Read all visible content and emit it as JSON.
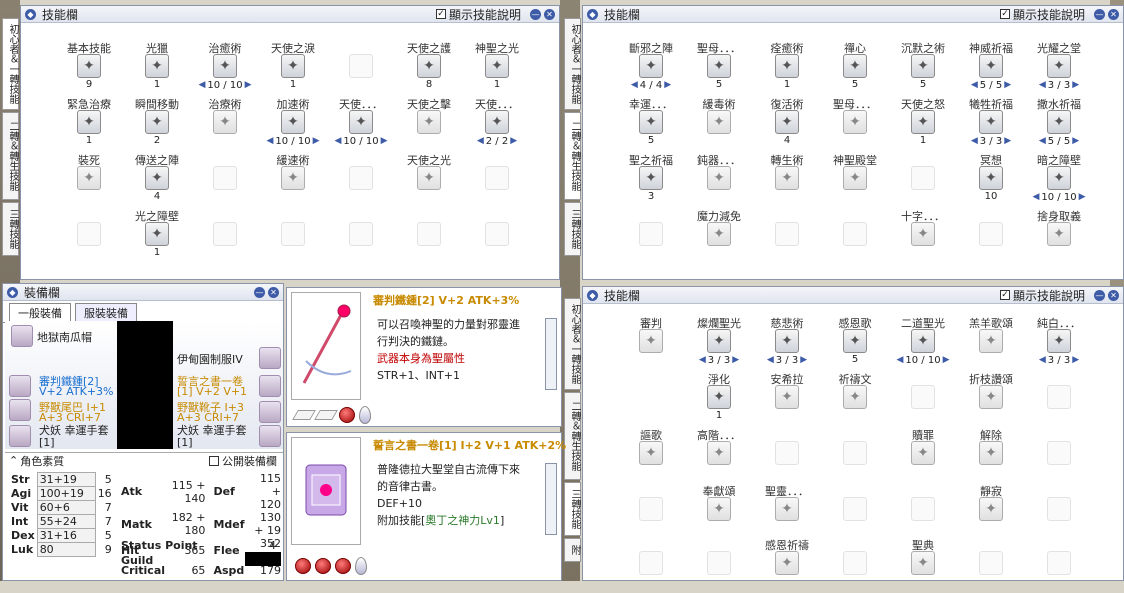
{
  "skill_tabs": [
    "初心者＆一轉技能",
    "二轉＆轉生技能",
    "三轉技能"
  ],
  "skill_tabs_short": [
    "三轉技能",
    "附"
  ],
  "win1": {
    "title": "技能欄",
    "show_desc": "顯示技能說明",
    "skills": [
      {
        "name": "基本技能",
        "level": "9",
        "icon": "chat-icon"
      },
      {
        "name": "光獵",
        "level": "1",
        "icon": "orb-icon"
      },
      {
        "name": "治癒術",
        "level": "10 / 10",
        "icon": "heart-icon",
        "ctl": true
      },
      {
        "name": "天使之淚",
        "level": "1",
        "icon": "tear-icon"
      },
      {
        "name": "天使之護",
        "level": "8",
        "icon": "wing-icon"
      },
      {
        "name": "神聖之光",
        "level": "1",
        "icon": "light-icon"
      },
      {
        "name": "緊急治療",
        "level": "1",
        "icon": "cross-icon"
      },
      {
        "name": "瞬間移動",
        "level": "2",
        "icon": "warp-icon"
      },
      {
        "name": "治療術",
        "level": "",
        "icon": "heart-gray-icon",
        "gray": true
      },
      {
        "name": "加速術",
        "level": "10 / 10",
        "icon": "speed-icon",
        "ctl": true
      },
      {
        "name": "天使．．．",
        "level": "10 / 10",
        "icon": "halo-icon",
        "ctl": true
      },
      {
        "name": "天使之擊",
        "level": "",
        "icon": "blade-icon",
        "gray": true
      },
      {
        "name": "天使．．．",
        "level": "2 / 2",
        "icon": "bell-icon",
        "ctl": true
      },
      {
        "name": "裝死",
        "level": "",
        "icon": "skull-icon",
        "gray": true
      },
      {
        "name": "傳送之陣",
        "level": "4",
        "icon": "portal-icon"
      },
      {
        "name": "緩速術",
        "level": "",
        "icon": "slow-icon",
        "gray": true
      },
      {
        "name": "天使之光",
        "level": "",
        "icon": "ring-icon",
        "gray": true
      },
      {
        "name": "光之障壁",
        "level": "1",
        "icon": "shield-icon"
      }
    ]
  },
  "win2": {
    "title": "技能欄",
    "show_desc": "顯示技能說明",
    "skills": [
      {
        "name": "斷邪之陣",
        "level": "4 / 4",
        "icon": "star-icon",
        "ctl": true
      },
      {
        "name": "聖母．．．",
        "level": "5",
        "icon": "mother-icon"
      },
      {
        "name": "痊癒術",
        "level": "1",
        "icon": "cure-icon"
      },
      {
        "name": "禪心",
        "level": "5",
        "icon": "zen-icon"
      },
      {
        "name": "沉默之術",
        "level": "5",
        "icon": "silence-icon"
      },
      {
        "name": "神威祈福",
        "level": "5 / 5",
        "icon": "bless-icon",
        "ctl": true
      },
      {
        "name": "光耀之堂",
        "level": "3 / 3",
        "icon": "hall-icon",
        "ctl": true
      },
      {
        "name": "幸運．．．",
        "level": "5",
        "icon": "luck-icon"
      },
      {
        "name": "緩毒術",
        "level": "",
        "icon": "poison-icon",
        "gray": true
      },
      {
        "name": "復活術",
        "level": "4",
        "icon": "revive-icon"
      },
      {
        "name": "聖母．．．",
        "level": "",
        "icon": "mother2-icon",
        "gray": true
      },
      {
        "name": "天使之怒",
        "level": "1",
        "icon": "wrath-icon"
      },
      {
        "name": "犧牲祈福",
        "level": "3 / 3",
        "icon": "sacrifice-icon",
        "ctl": true
      },
      {
        "name": "撒水祈福",
        "level": "5 / 5",
        "icon": "water-icon",
        "ctl": true
      },
      {
        "name": "聖之祈福",
        "level": "3",
        "icon": "holy-bless-icon"
      },
      {
        "name": "鈍器．．．",
        "level": "",
        "icon": "mace-icon",
        "gray": true
      },
      {
        "name": "轉生術",
        "level": "",
        "icon": "rebirth-icon",
        "gray": true
      },
      {
        "name": "神聖殿堂",
        "level": "",
        "icon": "temple-icon",
        "gray": true
      },
      {
        "name": "冥想",
        "level": "10",
        "icon": "meditate-icon"
      },
      {
        "name": "暗之障壁",
        "level": "10 / 10",
        "icon": "dark-shield-icon",
        "ctl": true
      },
      {
        "name": "魔力減免",
        "level": "",
        "icon": "spark-icon",
        "gray": true
      },
      {
        "name": "十字．．．",
        "level": "",
        "icon": "cross2-icon",
        "gray": true
      },
      {
        "name": "捨身取義",
        "level": "",
        "icon": "burst-icon",
        "gray": true
      }
    ]
  },
  "win3": {
    "title": "技能欄",
    "show_desc": "顯示技能說明",
    "skills": [
      {
        "name": "審判",
        "level": "",
        "icon": "judge-icon",
        "gray": true
      },
      {
        "name": "燦爛聖光",
        "level": "3 / 3",
        "icon": "radiant-icon",
        "ctl": true
      },
      {
        "name": "慈悲術",
        "level": "3 / 3",
        "icon": "mercy-icon",
        "ctl": true
      },
      {
        "name": "感恩歌",
        "level": "5",
        "icon": "thanks-icon"
      },
      {
        "name": "二道聖光",
        "level": "10 / 10",
        "icon": "double-light-icon",
        "ctl": true
      },
      {
        "name": "羔羊歌頌",
        "level": "",
        "icon": "lamb-icon",
        "gray": true
      },
      {
        "name": "純白．．．",
        "level": "3 / 3",
        "icon": "white-icon",
        "ctl": true
      },
      {
        "name": "淨化",
        "level": "1",
        "icon": "purify-icon"
      },
      {
        "name": "安希拉",
        "level": "",
        "icon": "ansira-icon",
        "gray": true
      },
      {
        "name": "祈禱文",
        "level": "",
        "icon": "prayer-icon",
        "gray": true
      },
      {
        "name": "折枝讚頌",
        "level": "",
        "icon": "branch-icon",
        "gray": true
      },
      {
        "name": "謳歌",
        "level": "",
        "icon": "song-icon",
        "gray": true
      },
      {
        "name": "高階．．．",
        "level": "",
        "icon": "high-icon",
        "gray": true
      },
      {
        "name": "贖罪",
        "level": "",
        "icon": "atone-icon",
        "gray": true
      },
      {
        "name": "解除",
        "level": "",
        "icon": "release-icon",
        "gray": true
      },
      {
        "name": "奉獻頌",
        "level": "",
        "icon": "offer-icon",
        "gray": true
      },
      {
        "name": "聖靈．．．",
        "level": "",
        "icon": "spirit-icon",
        "gray": true
      },
      {
        "name": "靜寂",
        "level": "",
        "icon": "quiet-icon",
        "gray": true
      },
      {
        "name": "感恩祈禱",
        "level": "",
        "icon": "grace-icon",
        "gray": true
      },
      {
        "name": "聖典",
        "level": "",
        "icon": "scripture-icon",
        "gray": true
      }
    ]
  },
  "equip": {
    "title": "裝備欄",
    "tab_general": "一般裝備",
    "tab_costume": "服裝裝備",
    "head": "地獄南瓜帽",
    "armor": "伊甸園制服IV",
    "weapon_line1": "審判鐵鍾[2]",
    "weapon_line2": "V+2 ATK+3%",
    "shield_line1": "誓言之書一卷",
    "shield_line2": "[1] V+2 V+1",
    "garment_line1": "野獸尾巴 I+1",
    "garment_line2": "A+3 CRI+7",
    "shoes_line1": "野獸靴子 I+3",
    "shoes_line2": "A+3 CRI+7",
    "acc1": "犬妖 幸運手套 [1]",
    "acc2": "犬妖 幸運手套 [1]",
    "stats_label": "角色素質",
    "public_label": "公開裝備欄"
  },
  "stats": [
    {
      "k": "Str",
      "v": "31+19",
      "n": "5"
    },
    {
      "k": "Agi",
      "v": "100+19",
      "n": "16"
    },
    {
      "k": "Vit",
      "v": "60+6",
      "n": "7"
    },
    {
      "k": "Int",
      "v": "55+24",
      "n": "7"
    },
    {
      "k": "Dex",
      "v": "31+16",
      "n": "5"
    },
    {
      "k": "Luk",
      "v": "80",
      "n": "9"
    }
  ],
  "stats2": [
    {
      "k": "Atk",
      "v": "115 + 140",
      "k2": "Def",
      "v2": "115 + 120"
    },
    {
      "k": "Matk",
      "v": "182 + 180",
      "k2": "Mdef",
      "v2": "130 + 19"
    },
    {
      "k": "Hit",
      "v": "365",
      "k2": "Flee",
      "v2": "352 + 9"
    },
    {
      "k": "Critical",
      "v": "65",
      "k2": "Aspd",
      "v2": "179"
    }
  ],
  "status_point_label": "Status Point",
  "status_point": "4",
  "guild_label": "Guild",
  "item1": {
    "title": "審判鐵鍾[2] V+2 ATK+3%",
    "l1": "可以召喚神聖的力量對邪靈進",
    "l2": "行判決的鐵鏈。",
    "l3": "武器本身為聖屬性",
    "l4": "STR+1、INT+1"
  },
  "item2": {
    "title": "誓言之書一卷[1] I+2 V+1 ATK+2%",
    "l1": "普隆德拉大聖堂自古流傳下來",
    "l2": "的音律古書。",
    "l3": "DEF+10",
    "l4a": "附加技能[",
    "l4b": "奧丁之神力Lv1",
    "l4c": "]"
  }
}
